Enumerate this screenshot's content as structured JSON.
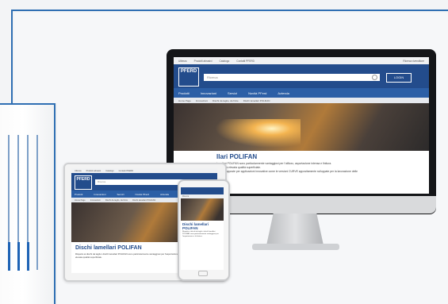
{
  "colors": {
    "accent": "#2f6fb3",
    "brand_blue": "#234c8c",
    "nav_blue": "#2c5fa6"
  },
  "desktop": {
    "topbar": {
      "links": [
        "Ultimos",
        "Prodotti abrasivi",
        "Catalogo",
        "Contatti PFERD"
      ],
      "right": "Ricerca rivenditore"
    },
    "logo": "PFERD",
    "search_placeholder": "Ricerca",
    "login_label": "LOGIN",
    "nav_items": [
      "Prodotti",
      "Innovazioni",
      "Servizi",
      "Novità PFerd",
      "Azienda"
    ],
    "breadcrumbs": [
      "Home Page",
      "Innovazioni",
      "Dischi da taglio, da finire",
      "Dischi lamellari POLIFAN"
    ],
    "page_title": "llari POLIFAN",
    "body_lines": [
      "lamellari POLIFAN sono particolarmente vantaggiosi per l'utilizzo, asportazione intensa e finitura.",
      "pupo una elevata qualità superficiale.",
      "llamate apposte per applicazioni innovative come le versioni CURVE appositamente sviluppate per la lavorazione delle"
    ]
  },
  "tablet": {
    "topbar": [
      "Ultimos",
      "Prodotti abrasivi",
      "Catalogo",
      "Contatti PFERD"
    ],
    "logo": "PFERD",
    "search_placeholder": "Ricerca",
    "nav_items": [
      "Prodotti",
      "Innovazioni",
      "Servizi",
      "Novità PFerd",
      "Azienda"
    ],
    "breadcrumbs": [
      "Home Page",
      "Innovazioni",
      "Dischi da taglio, da finire",
      "Dischi lamellari POLIFAN"
    ],
    "title": "Dischi lamellari POLIFAN",
    "body": "Rispetto ai dischi da taglio i dischi lamellari POLIFAN sono particolarmente vantaggiosi per l'asportazione intensa e la finitura, con una elevata qualità superficiale."
  },
  "phone": {
    "search_placeholder": "Ricerca",
    "title": "Dischi lamellari POLIFAN",
    "body": "Rispetto ai dischi da taglio i dischi lamellari POLIFAN sono particolarmente vantaggiosi per l'asportazione e la finitura."
  }
}
